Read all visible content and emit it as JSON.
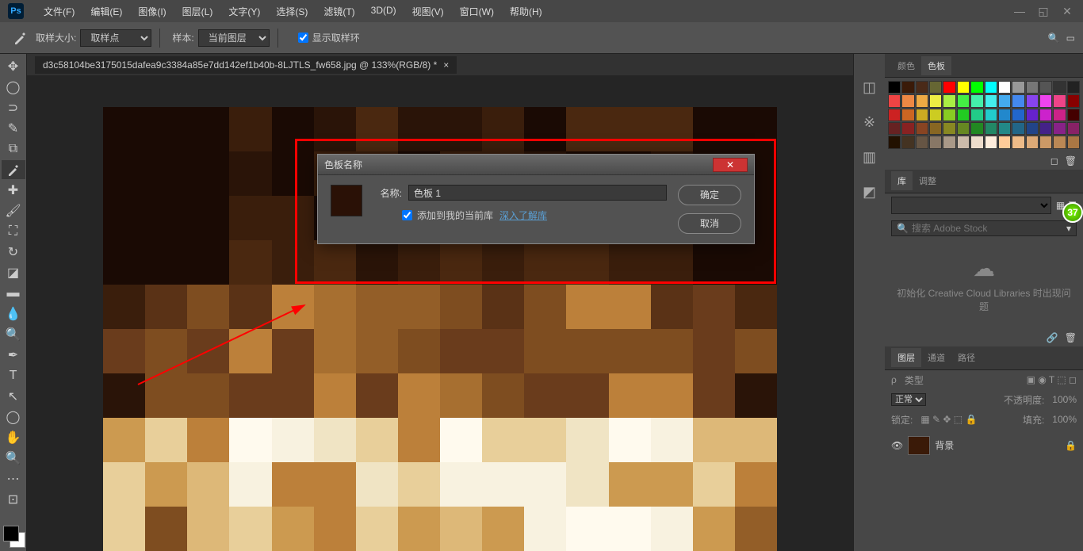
{
  "menubar": {
    "items": [
      "文件(F)",
      "编辑(E)",
      "图像(I)",
      "图层(L)",
      "文字(Y)",
      "选择(S)",
      "滤镜(T)",
      "3D(D)",
      "视图(V)",
      "窗口(W)",
      "帮助(H)"
    ]
  },
  "options": {
    "sample_size_label": "取样大小:",
    "sample_size_value": "取样点",
    "sample_label": "样本:",
    "sample_value": "当前图层",
    "show_ring": "显示取样环"
  },
  "tab": {
    "filename": "d3c58104be3175015dafea9c3384a85e7dd142ef1b40b-8LJTLS_fw658.jpg @ 133%(RGB/8) *"
  },
  "dialog": {
    "title": "色板名称",
    "name_label": "名称:",
    "name_value": "色板 1",
    "add_to_lib": "添加到我的当前库",
    "learn_more": "深入了解库",
    "ok": "确定",
    "cancel": "取消"
  },
  "panels": {
    "color_tab": "颜色",
    "swatches_tab": "色板",
    "lib_tab": "库",
    "adjust_tab": "调整",
    "search_placeholder": "搜索 Adobe Stock",
    "cloud_error": "初始化 Creative Cloud Libraries 时出现问题",
    "layers_tab": "图层",
    "channels_tab": "通道",
    "paths_tab": "路径",
    "type_label": "类型",
    "blend": "正常",
    "opacity_label": "不透明度:",
    "opacity_val": "100%",
    "lock_label": "锁定:",
    "fill_label": "填充:",
    "fill_val": "100%",
    "bg_layer": "背景"
  },
  "swatch_colors": [
    "#000",
    "#3a1a08",
    "#4a2a18",
    "#663",
    "#f00",
    "#ff0",
    "#0f0",
    "#0ff",
    "#fff",
    "#999",
    "#777",
    "#555",
    "#333",
    "#222",
    "#e44",
    "#e84",
    "#ea4",
    "#ee4",
    "#ae4",
    "#4e4",
    "#4ea",
    "#4ee",
    "#4ae",
    "#48e",
    "#84e",
    "#e4e",
    "#e48",
    "#800",
    "#c22",
    "#c62",
    "#ca2",
    "#cc2",
    "#8c2",
    "#2c2",
    "#2c8",
    "#2cc",
    "#28c",
    "#26c",
    "#62c",
    "#c2c",
    "#c28",
    "#400",
    "#622",
    "#822",
    "#842",
    "#862",
    "#882",
    "#682",
    "#282",
    "#286",
    "#288",
    "#268",
    "#248",
    "#428",
    "#828",
    "#826",
    "#210",
    "#432",
    "#654",
    "#876",
    "#a98",
    "#cba",
    "#edc",
    "#fed",
    "#fc9",
    "#eb8",
    "#da7",
    "#c96",
    "#b85",
    "#a74"
  ],
  "badge": "37"
}
